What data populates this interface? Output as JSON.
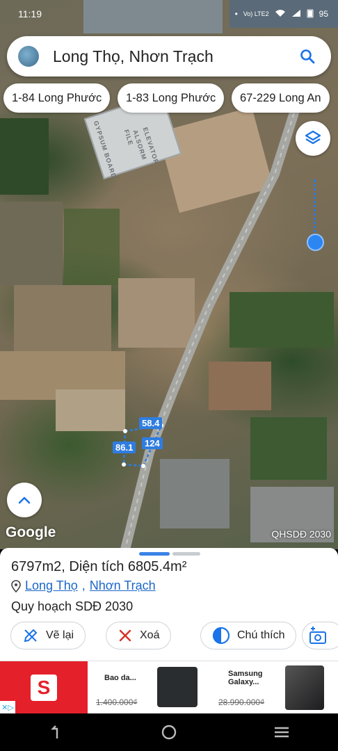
{
  "status_bar": {
    "time": "11:19",
    "network": "Vo) LTE2",
    "battery": "95"
  },
  "search": {
    "title": "Long Thọ, Nhơn Trạch"
  },
  "chips": [
    {
      "label": "1-84 Long Phước"
    },
    {
      "label": "1-83 Long Phước"
    },
    {
      "label": "67-229 Long An"
    }
  ],
  "map": {
    "building_labels": [
      "GYPSUM BOARD",
      "FILE",
      "ALSORM",
      "ELEVATOR"
    ],
    "measurements": {
      "top": "58.4",
      "left": "86.1",
      "right": "124"
    },
    "google_logo": "Google",
    "layer_label": "QHSDĐ 2030"
  },
  "sheet": {
    "title": "6797m2, Diện tích 6805.4m²",
    "location_part1": "Long Thọ",
    "location_sep": ",",
    "location_part2": "Nhơn Trạch",
    "plan": "Quy hoạch SDĐ 2030",
    "actions": [
      {
        "label": "Vẽ lại",
        "icon": "redraw-icon"
      },
      {
        "label": "Xoá",
        "icon": "close-icon"
      },
      {
        "label": "Chú thích",
        "icon": "legend-icon"
      }
    ]
  },
  "ad": {
    "items": [
      {
        "name": "Bao da...",
        "price": "1.400.000₫"
      },
      {
        "name": "Samsung Galaxy...",
        "price": "28.990.000₫"
      }
    ],
    "colors": {
      "brand": "#e4202b",
      "accent": "#29a3e0"
    }
  },
  "colors": {
    "accent": "#1a73e8",
    "measure": "#2f7de1",
    "close": "#d93025"
  }
}
